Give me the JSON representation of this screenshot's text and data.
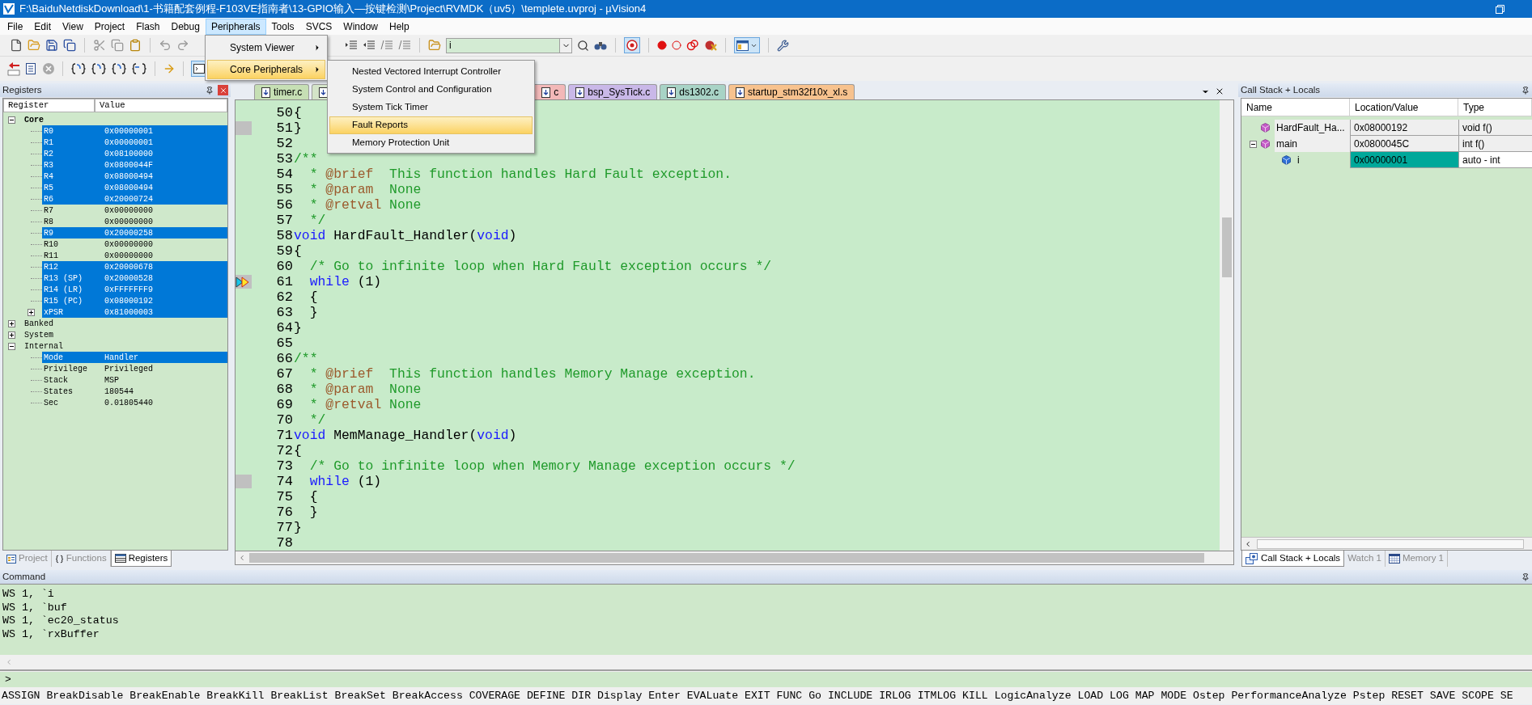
{
  "window": {
    "title": "F:\\BaiduNetdiskDownload\\1-书籍配套例程-F103VE指南者\\13-GPIO输入—按键检测\\Project\\RVMDK（uv5）\\templete.uvproj - µVision4"
  },
  "menu": [
    {
      "label": "File",
      "selected": false
    },
    {
      "label": "Edit",
      "selected": false
    },
    {
      "label": "View",
      "selected": false
    },
    {
      "label": "Project",
      "selected": false
    },
    {
      "label": "Flash",
      "selected": false
    },
    {
      "label": "Debug",
      "selected": false
    },
    {
      "label": "Peripherals",
      "selected": true
    },
    {
      "label": "Tools",
      "selected": false
    },
    {
      "label": "SVCS",
      "selected": false
    },
    {
      "label": "Window",
      "selected": false
    },
    {
      "label": "Help",
      "selected": false
    }
  ],
  "peripherals_menu": [
    {
      "label": "System Viewer",
      "selected": false
    },
    {
      "label": "Core Peripherals",
      "selected": true
    }
  ],
  "core_peripherals_menu": [
    {
      "label": "Nested Vectored Interrupt Controller",
      "selected": false
    },
    {
      "label": "System Control and Configuration",
      "selected": false
    },
    {
      "label": "System Tick Timer",
      "selected": false
    },
    {
      "label": "Fault Reports",
      "selected": true
    },
    {
      "label": "Memory Protection Unit",
      "selected": false
    }
  ],
  "toolbar": {
    "find_value": "i"
  },
  "registers": {
    "title": "Registers",
    "columns": [
      "Register",
      "Value"
    ],
    "tree": [
      {
        "name": "Core",
        "bold": true,
        "expanded": true,
        "selected": false,
        "children": [
          {
            "name": "R0",
            "value": "0x00000001",
            "selected": true
          },
          {
            "name": "R1",
            "value": "0x00000001",
            "selected": true
          },
          {
            "name": "R2",
            "value": "0x08100000",
            "selected": true
          },
          {
            "name": "R3",
            "value": "0x0800044F",
            "selected": true
          },
          {
            "name": "R4",
            "value": "0x08000494",
            "selected": true
          },
          {
            "name": "R5",
            "value": "0x08000494",
            "selected": true
          },
          {
            "name": "R6",
            "value": "0x20000724",
            "selected": true
          },
          {
            "name": "R7",
            "value": "0x00000000",
            "selected": false
          },
          {
            "name": "R8",
            "value": "0x00000000",
            "selected": false
          },
          {
            "name": "R9",
            "value": "0x20000258",
            "selected": true
          },
          {
            "name": "R10",
            "value": "0x00000000",
            "selected": false
          },
          {
            "name": "R11",
            "value": "0x00000000",
            "selected": false
          },
          {
            "name": "R12",
            "value": "0x20000678",
            "selected": true
          },
          {
            "name": "R13 (SP)",
            "value": "0x20000528",
            "selected": true
          },
          {
            "name": "R14 (LR)",
            "value": "0xFFFFFFF9",
            "selected": true
          },
          {
            "name": "R15 (PC)",
            "value": "0x08000192",
            "selected": true
          },
          {
            "name": "xPSR",
            "value": "0x81000003",
            "selected": true,
            "expanded": false
          }
        ]
      },
      {
        "name": "Banked",
        "bold": false,
        "expanded": false,
        "selected": false
      },
      {
        "name": "System",
        "bold": false,
        "expanded": false,
        "selected": false
      },
      {
        "name": "Internal",
        "bold": false,
        "expanded": true,
        "selected": false,
        "children": [
          {
            "name": "Mode",
            "value": "Handler",
            "selected": true
          },
          {
            "name": "Privilege",
            "value": "Privileged",
            "selected": false
          },
          {
            "name": "Stack",
            "value": "MSP",
            "selected": false
          },
          {
            "name": "States",
            "value": "180544",
            "selected": false
          },
          {
            "name": "Sec",
            "value": "0.01805440",
            "selected": false
          }
        ]
      }
    ],
    "tabs": [
      {
        "label": "Project",
        "selected": false
      },
      {
        "label": "Functions",
        "selected": false
      },
      {
        "label": "Registers",
        "selected": true
      }
    ]
  },
  "editor": {
    "tabs": [
      {
        "label": "timer.c",
        "color": "#c6dfb4"
      },
      {
        "color": "#d4e4c8"
      },
      {
        "label": "c",
        "color": "#f2b8b8"
      },
      {
        "label": "bsp_SysTick.c",
        "color": "#c9b8e8"
      },
      {
        "label": "ds1302.c",
        "color": "#a8d3c6"
      },
      {
        "label": "startup_stm32f10x_xl.s",
        "color": "#f7c28e"
      }
    ],
    "lines": [
      {
        "kind": "line",
        "num": "50",
        "segments": [
          {
            "kind": "plain",
            "text": "{"
          }
        ]
      },
      {
        "kind": "code",
        "num": "51",
        "segments": [
          {
            "kind": "plain",
            "text": "}"
          }
        ]
      },
      {
        "kind": "line",
        "num": "52"
      },
      {
        "kind": "line",
        "num": "53",
        "segments": [
          {
            "kind": "comment",
            "text": "/**"
          }
        ]
      },
      {
        "kind": "line",
        "num": "54",
        "segments": [
          {
            "kind": "comment",
            "text": "  * "
          },
          {
            "kind": "doctag",
            "text": "@brief"
          },
          {
            "kind": "comment",
            "text": "  This function handles Hard Fault exception."
          }
        ]
      },
      {
        "kind": "line",
        "num": "55",
        "segments": [
          {
            "kind": "comment",
            "text": "  * "
          },
          {
            "kind": "doctag",
            "text": "@param"
          },
          {
            "kind": "comment",
            "text": "  None"
          }
        ]
      },
      {
        "kind": "line",
        "num": "56",
        "segments": [
          {
            "kind": "comment",
            "text": "  * "
          },
          {
            "kind": "doctag",
            "text": "@retval"
          },
          {
            "kind": "comment",
            "text": " None"
          }
        ]
      },
      {
        "kind": "line",
        "num": "57",
        "segments": [
          {
            "kind": "comment",
            "text": "  */"
          }
        ]
      },
      {
        "kind": "line",
        "num": "58",
        "segments": [
          {
            "kind": "keyword",
            "text": "void"
          },
          {
            "kind": "plain",
            "text": " HardFault_Handler("
          },
          {
            "kind": "keyword",
            "text": "void"
          },
          {
            "kind": "plain",
            "text": ")"
          }
        ]
      },
      {
        "kind": "line",
        "num": "59",
        "segments": [
          {
            "kind": "plain",
            "text": "{"
          }
        ]
      },
      {
        "kind": "line",
        "num": "60",
        "segments": [
          {
            "kind": "comment",
            "text": "  /* Go to infinite loop when Hard Fault exception occurs */"
          }
        ]
      },
      {
        "kind": "current",
        "num": "61",
        "segments": [
          {
            "kind": "keyword",
            "text": "  while"
          },
          {
            "kind": "plain",
            "text": " (1)"
          }
        ]
      },
      {
        "kind": "line",
        "num": "62",
        "segments": [
          {
            "kind": "plain",
            "text": "  {"
          }
        ]
      },
      {
        "kind": "line",
        "num": "63",
        "segments": [
          {
            "kind": "plain",
            "text": "  }"
          }
        ]
      },
      {
        "kind": "line",
        "num": "64",
        "segments": [
          {
            "kind": "plain",
            "text": "}"
          }
        ]
      },
      {
        "kind": "line",
        "num": "65"
      },
      {
        "kind": "line",
        "num": "66",
        "segments": [
          {
            "kind": "comment",
            "text": "/**"
          }
        ]
      },
      {
        "kind": "line",
        "num": "67",
        "segments": [
          {
            "kind": "comment",
            "text": "  * "
          },
          {
            "kind": "doctag",
            "text": "@brief"
          },
          {
            "kind": "comment",
            "text": "  This function handles Memory Manage exception."
          }
        ]
      },
      {
        "kind": "line",
        "num": "68",
        "segments": [
          {
            "kind": "comment",
            "text": "  * "
          },
          {
            "kind": "doctag",
            "text": "@param"
          },
          {
            "kind": "comment",
            "text": "  None"
          }
        ]
      },
      {
        "kind": "line",
        "num": "69",
        "segments": [
          {
            "kind": "comment",
            "text": "  * "
          },
          {
            "kind": "doctag",
            "text": "@retval"
          },
          {
            "kind": "comment",
            "text": " None"
          }
        ]
      },
      {
        "kind": "line",
        "num": "70",
        "segments": [
          {
            "kind": "comment",
            "text": "  */"
          }
        ]
      },
      {
        "kind": "line",
        "num": "71",
        "segments": [
          {
            "kind": "keyword",
            "text": "void"
          },
          {
            "kind": "plain",
            "text": " MemManage_Handler("
          },
          {
            "kind": "keyword",
            "text": "void"
          },
          {
            "kind": "plain",
            "text": ")"
          }
        ]
      },
      {
        "kind": "line",
        "num": "72",
        "segments": [
          {
            "kind": "plain",
            "text": "{"
          }
        ]
      },
      {
        "kind": "line",
        "num": "73",
        "segments": [
          {
            "kind": "comment",
            "text": "  /* Go to infinite loop when Memory Manage exception occurs */"
          }
        ]
      },
      {
        "kind": "code",
        "num": "74",
        "segments": [
          {
            "kind": "keyword",
            "text": "  while"
          },
          {
            "kind": "plain",
            "text": " (1)"
          }
        ]
      },
      {
        "kind": "line",
        "num": "75",
        "segments": [
          {
            "kind": "plain",
            "text": "  {"
          }
        ]
      },
      {
        "kind": "line",
        "num": "76",
        "segments": [
          {
            "kind": "plain",
            "text": "  }"
          }
        ]
      },
      {
        "kind": "line",
        "num": "77",
        "segments": [
          {
            "kind": "plain",
            "text": "}"
          }
        ]
      },
      {
        "kind": "line",
        "num": "78"
      }
    ]
  },
  "call_stack": {
    "title": "Call Stack + Locals",
    "columns": [
      "Name",
      "Location/Value",
      "Type"
    ],
    "rows": [
      {
        "kind": "function",
        "name": "HardFault_Ha...",
        "location": "0x08000192",
        "type": "void f()",
        "changed": false
      },
      {
        "kind": "function",
        "name": "main",
        "location": "0x0800045C",
        "type": "int f()",
        "changed": false,
        "expanded": true,
        "children": [
          {
            "kind": "variable",
            "name": "i",
            "location": "0x00000001",
            "type": "auto - int",
            "changed": true
          }
        ]
      }
    ],
    "tabs": [
      {
        "label": "Call Stack + Locals",
        "selected": true
      },
      {
        "label": "Watch 1",
        "selected": false
      },
      {
        "label": "Memory 1",
        "selected": false
      }
    ]
  },
  "command": {
    "title": "Command",
    "output": [
      "WS 1, `i",
      "WS 1, `buf",
      "WS 1, `ec20_status",
      "WS 1, `rxBuffer"
    ],
    "prompt": ">",
    "help": "ASSIGN BreakDisable BreakEnable BreakKill BreakList BreakSet BreakAccess COVERAGE DEFINE DIR Display Enter EVALuate EXIT FUNC Go INCLUDE IRLOG ITMLOG KILL LogicAnalyze LOAD LOG MAP MODE Ostep PerformanceAnalyze Pstep RESET SAVE SCOPE SE"
  }
}
